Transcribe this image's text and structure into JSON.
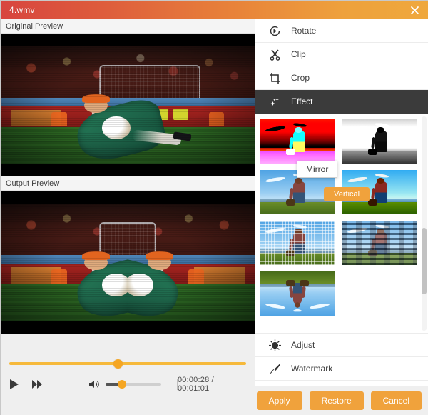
{
  "window": {
    "title": "4.wmv",
    "close_icon": "close-icon",
    "gradient_left": "#d8453f",
    "gradient_right": "#efa83d"
  },
  "previews": {
    "original_label": "Original Preview",
    "output_label": "Output Preview"
  },
  "player": {
    "play_icon": "play-icon",
    "forward_icon": "fast-forward-icon",
    "volume_icon": "speaker-icon",
    "current_time": "00:00:28",
    "total_time": "00:01:01",
    "time_display": "00:00:28 / 00:01:01",
    "progress_percent": 46,
    "volume_percent": 30,
    "accent_color": "#f5a623"
  },
  "panel": {
    "menu_top": [
      {
        "label": "Rotate",
        "icon": "rotate-icon",
        "active": false
      },
      {
        "label": "Clip",
        "icon": "scissors-icon",
        "active": false
      },
      {
        "label": "Crop",
        "icon": "crop-icon",
        "active": false
      },
      {
        "label": "Effect",
        "icon": "sparkle-icon",
        "active": true
      }
    ],
    "menu_bottom": [
      {
        "label": "Adjust",
        "icon": "brightness-icon",
        "active": false
      },
      {
        "label": "Watermark",
        "icon": "brush-icon",
        "active": false
      }
    ],
    "effects": [
      {
        "name": "Sketch",
        "style": "sketch",
        "selected": false
      },
      {
        "name": "Gray",
        "style": "gray",
        "selected": false
      },
      {
        "name": "Original",
        "style": "none",
        "selected": false
      },
      {
        "name": "Sharpen",
        "style": "sharp",
        "selected": false
      },
      {
        "name": "Mosaic",
        "style": "mosaic",
        "selected": false
      },
      {
        "name": "Glass",
        "style": "glass",
        "selected": false
      },
      {
        "name": "Mirror",
        "style": "mirror",
        "selected": true
      }
    ],
    "tooltip": "Mirror",
    "vertical_button": "Vertical",
    "selected_border_color": "#e03a2f",
    "active_menu_bg": "#3b3b3b"
  },
  "footer": {
    "apply_label": "Apply",
    "restore_label": "Restore",
    "cancel_label": "Cancel",
    "button_color": "#f0a23c"
  }
}
